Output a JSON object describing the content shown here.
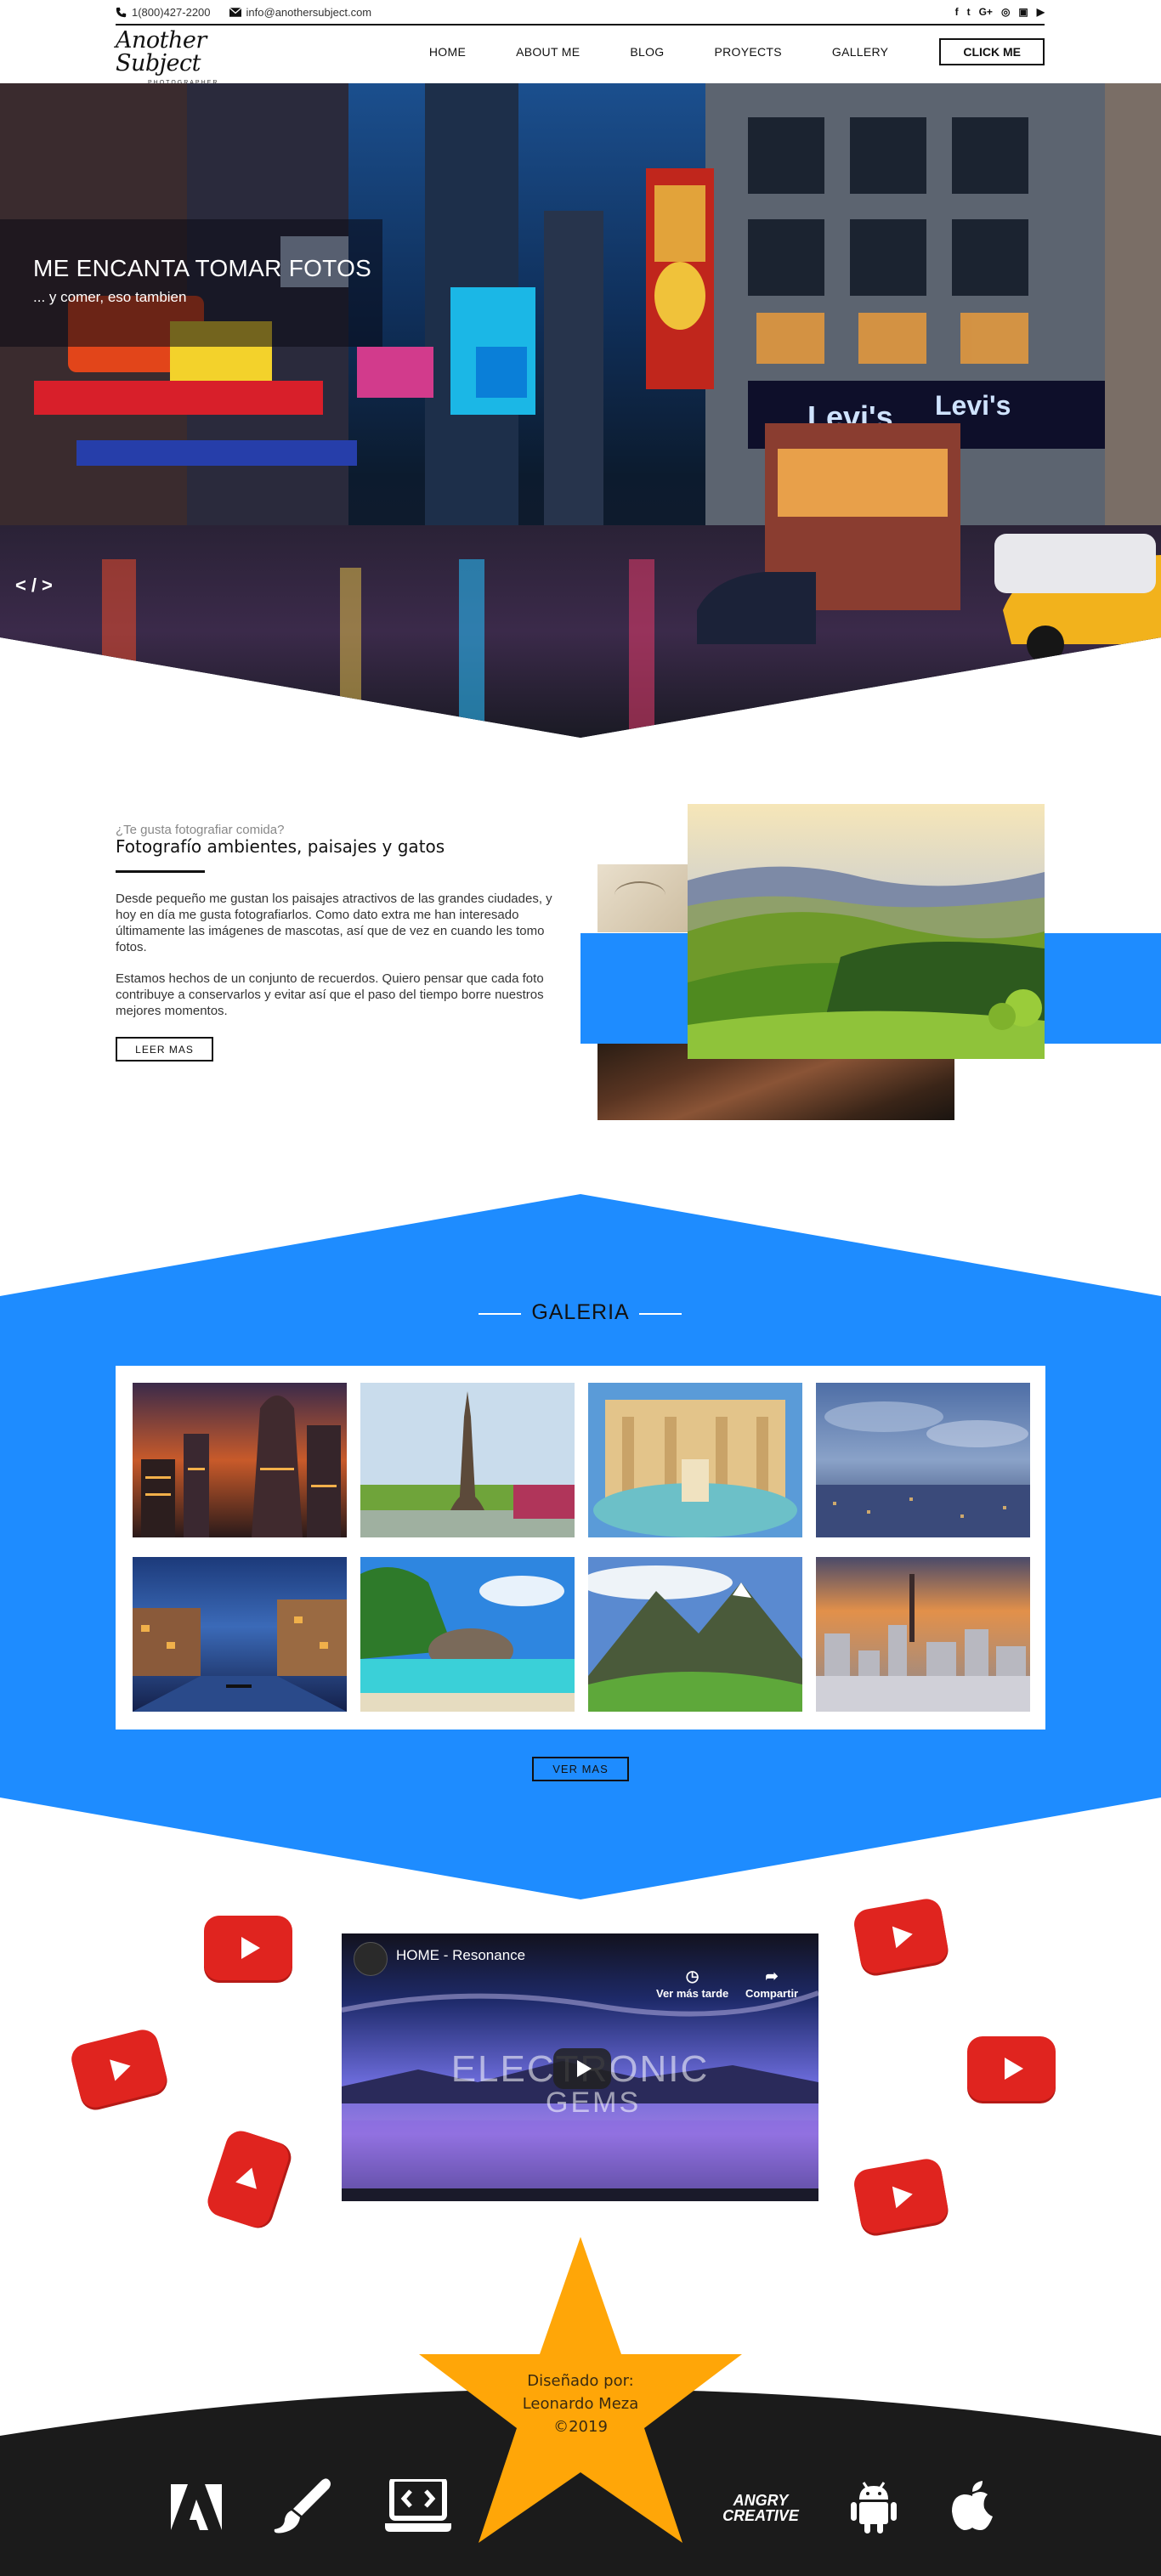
{
  "topbar": {
    "phone": "1(800)427-2200",
    "email": "info@anothersubject.com",
    "social_icons": [
      "facebook-icon",
      "twitter-icon",
      "google-plus-icon",
      "instagram-icon",
      "twitch-icon",
      "youtube-icon"
    ],
    "social_glyphs": [
      "f",
      "t",
      "G+",
      "◎",
      "▣",
      "▶"
    ]
  },
  "logo": {
    "name": "Another Subject",
    "tagline": "PHOTOGRAPHER"
  },
  "nav": {
    "items": [
      "HOME",
      "ABOUT ME",
      "BLOG",
      "PROYECTS",
      "GALLERY"
    ],
    "cta": "CLICK ME"
  },
  "hero": {
    "title": "ME ENCANTA TOMAR FOTOS",
    "subtitle": "... y comer, eso tambien",
    "prev_arrow": "<",
    "separator": "/",
    "next_arrow": ">"
  },
  "about": {
    "kicker": "¿Te gusta fotografiar comida?",
    "title": "Fotografío ambientes, paisajes y gatos",
    "paragraph1": "Desde pequeño me gustan los paisajes atractivos de las grandes ciudades, y hoy en día me gusta fotografiarlos. Como dato extra me han interesado últimamente las imágenes de mascotas, así que de vez en cuando les tomo fotos.",
    "paragraph2": "Estamos hechos de un conjunto de recuerdos. Quiero pensar que cada foto contribuye a conservarlos y evitar así que el paso del tiempo borre nuestros mejores momentos.",
    "button": "LEER MAS"
  },
  "gallery": {
    "title": "GALERIA",
    "button": "VER MAS",
    "accent": "#1e8cff"
  },
  "video": {
    "title": "HOME - Resonance",
    "watch_later": "Ver más tarde",
    "share": "Compartir",
    "art_line1": "ELECTRONIC",
    "art_line2": "GEMS"
  },
  "footer": {
    "credit_label": "Diseñado por:",
    "credit_name": "Leonardo Meza",
    "credit_year": "©2019",
    "star_color": "#ffa608",
    "brand_text": "ANGRY CREATIVE"
  },
  "colors": {
    "blue": "#1e8cff",
    "dark": "#1b1b1b",
    "youtube_red": "#e0241f"
  }
}
